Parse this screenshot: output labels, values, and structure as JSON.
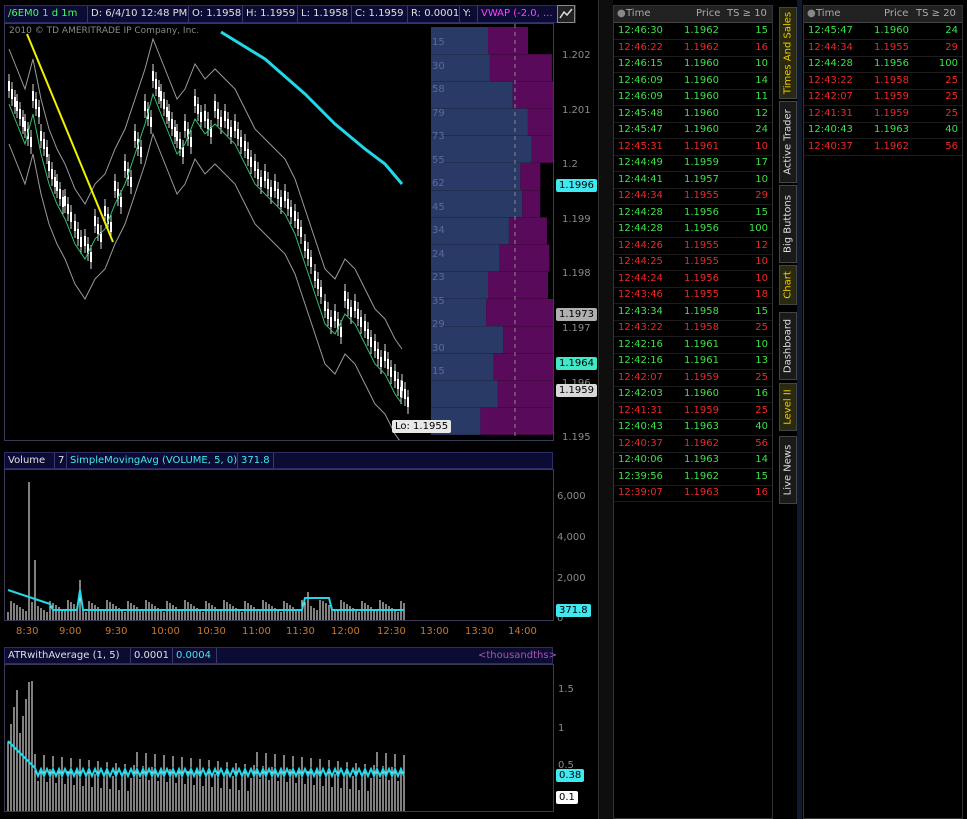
{
  "header": {
    "symbol": "/6EM0 1 d 1m",
    "date": "D: 6/4/10 12:48 PM",
    "open": "O: 1.1958",
    "high": "H: 1.1959",
    "low": "L: 1.1958",
    "close": "C: 1.1959",
    "range": "R: 0.0001",
    "y": "Y:",
    "vwap": "VWAP (-2.0, ..."
  },
  "watermark": "2010 © TD AMERITRADE IP Company, Inc.",
  "price_axis": [
    "1.202",
    "1.201",
    "1.2",
    "1.199",
    "1.198",
    "1.197",
    "1.196",
    "1.195"
  ],
  "price_tags": {
    "t1": "1.1996",
    "t2": "1.1973",
    "t3": "1.1964",
    "t4": "1.1959",
    "lo": "Lo: 1.1955"
  },
  "volume_profile": [
    "15",
    "30",
    "58",
    "79",
    "73",
    "55",
    "62",
    "45",
    "34",
    "24",
    "23",
    "35",
    "29",
    "30",
    "15"
  ],
  "volume_study": {
    "label": "Volume",
    "period": "7",
    "sma": "SimpleMovingAvg (VOLUME, 5, 0)",
    "value": "371.8"
  },
  "volume_axis": [
    "6,000",
    "4,000",
    "2,000",
    "0"
  ],
  "volume_tag": "371.8",
  "time_axis": [
    "8:30",
    "9:00",
    "9:30",
    "10:00",
    "10:30",
    "11:00",
    "11:30",
    "12:00",
    "12:30",
    "13:00",
    "13:30",
    "14:00"
  ],
  "atr_study": {
    "label": "ATRwithAverage (1, 5)",
    "v1": "0.0001",
    "v2": "0.0004",
    "units": "<thousandths>"
  },
  "atr_axis": [
    "1.5",
    "1",
    "0.5"
  ],
  "atr_tags": {
    "a": "0.38",
    "b": "0.1"
  },
  "ts1": {
    "headers": {
      "time": "Time",
      "price": "Price",
      "size": "TS ≥ 10"
    },
    "rows": [
      {
        "t": "12:46:30",
        "p": "1.1962",
        "s": "15",
        "c": "g"
      },
      {
        "t": "12:46:22",
        "p": "1.1962",
        "s": "16",
        "c": "r"
      },
      {
        "t": "12:46:15",
        "p": "1.1960",
        "s": "10",
        "c": "g"
      },
      {
        "t": "12:46:09",
        "p": "1.1960",
        "s": "14",
        "c": "g"
      },
      {
        "t": "12:46:09",
        "p": "1.1960",
        "s": "11",
        "c": "g"
      },
      {
        "t": "12:45:48",
        "p": "1.1960",
        "s": "12",
        "c": "g"
      },
      {
        "t": "12:45:47",
        "p": "1.1960",
        "s": "24",
        "c": "g"
      },
      {
        "t": "12:45:31",
        "p": "1.1961",
        "s": "10",
        "c": "r"
      },
      {
        "t": "12:44:49",
        "p": "1.1959",
        "s": "17",
        "c": "g"
      },
      {
        "t": "12:44:41",
        "p": "1.1957",
        "s": "10",
        "c": "g"
      },
      {
        "t": "12:44:34",
        "p": "1.1955",
        "s": "29",
        "c": "r"
      },
      {
        "t": "12:44:28",
        "p": "1.1956",
        "s": "15",
        "c": "g"
      },
      {
        "t": "12:44:28",
        "p": "1.1956",
        "s": "100",
        "c": "g"
      },
      {
        "t": "12:44:26",
        "p": "1.1955",
        "s": "12",
        "c": "r"
      },
      {
        "t": "12:44:25",
        "p": "1.1955",
        "s": "10",
        "c": "r"
      },
      {
        "t": "12:44:24",
        "p": "1.1956",
        "s": "10",
        "c": "r"
      },
      {
        "t": "12:43:46",
        "p": "1.1955",
        "s": "18",
        "c": "r"
      },
      {
        "t": "12:43:34",
        "p": "1.1958",
        "s": "15",
        "c": "g"
      },
      {
        "t": "12:43:22",
        "p": "1.1958",
        "s": "25",
        "c": "r"
      },
      {
        "t": "12:42:16",
        "p": "1.1961",
        "s": "10",
        "c": "g"
      },
      {
        "t": "12:42:16",
        "p": "1.1961",
        "s": "13",
        "c": "g"
      },
      {
        "t": "12:42:07",
        "p": "1.1959",
        "s": "25",
        "c": "r"
      },
      {
        "t": "12:42:03",
        "p": "1.1960",
        "s": "16",
        "c": "g"
      },
      {
        "t": "12:41:31",
        "p": "1.1959",
        "s": "25",
        "c": "r"
      },
      {
        "t": "12:40:43",
        "p": "1.1963",
        "s": "40",
        "c": "g"
      },
      {
        "t": "12:40:37",
        "p": "1.1962",
        "s": "56",
        "c": "r"
      },
      {
        "t": "12:40:06",
        "p": "1.1963",
        "s": "14",
        "c": "g"
      },
      {
        "t": "12:39:56",
        "p": "1.1962",
        "s": "15",
        "c": "g"
      },
      {
        "t": "12:39:07",
        "p": "1.1963",
        "s": "16",
        "c": "r"
      }
    ]
  },
  "ts2": {
    "headers": {
      "time": "Time",
      "price": "Price",
      "size": "TS ≥ 20"
    },
    "rows": [
      {
        "t": "12:45:47",
        "p": "1.1960",
        "s": "24",
        "c": "g"
      },
      {
        "t": "12:44:34",
        "p": "1.1955",
        "s": "29",
        "c": "r"
      },
      {
        "t": "12:44:28",
        "p": "1.1956",
        "s": "100",
        "c": "g"
      },
      {
        "t": "12:43:22",
        "p": "1.1958",
        "s": "25",
        "c": "r"
      },
      {
        "t": "12:42:07",
        "p": "1.1959",
        "s": "25",
        "c": "r"
      },
      {
        "t": "12:41:31",
        "p": "1.1959",
        "s": "25",
        "c": "r"
      },
      {
        "t": "12:40:43",
        "p": "1.1963",
        "s": "40",
        "c": "g"
      },
      {
        "t": "12:40:37",
        "p": "1.1962",
        "s": "56",
        "c": "r"
      }
    ]
  },
  "tabs": [
    {
      "label": "Times And Sales",
      "active": true
    },
    {
      "label": "Active Trader",
      "active": false
    },
    {
      "label": "Big Buttons",
      "active": false
    },
    {
      "label": "Chart",
      "active": true
    },
    {
      "label": "Dashboard",
      "active": false
    },
    {
      "label": "Level II",
      "active": true
    },
    {
      "label": "Live News",
      "active": false
    }
  ],
  "colors": {
    "up": "#3ee04a",
    "down": "#ee2828",
    "vwap": "#00d8e8",
    "bands": "#9a9a9a",
    "trend": "#f0f000",
    "profile_blue": "#2a3a66",
    "profile_purple": "#5a0a5a"
  }
}
